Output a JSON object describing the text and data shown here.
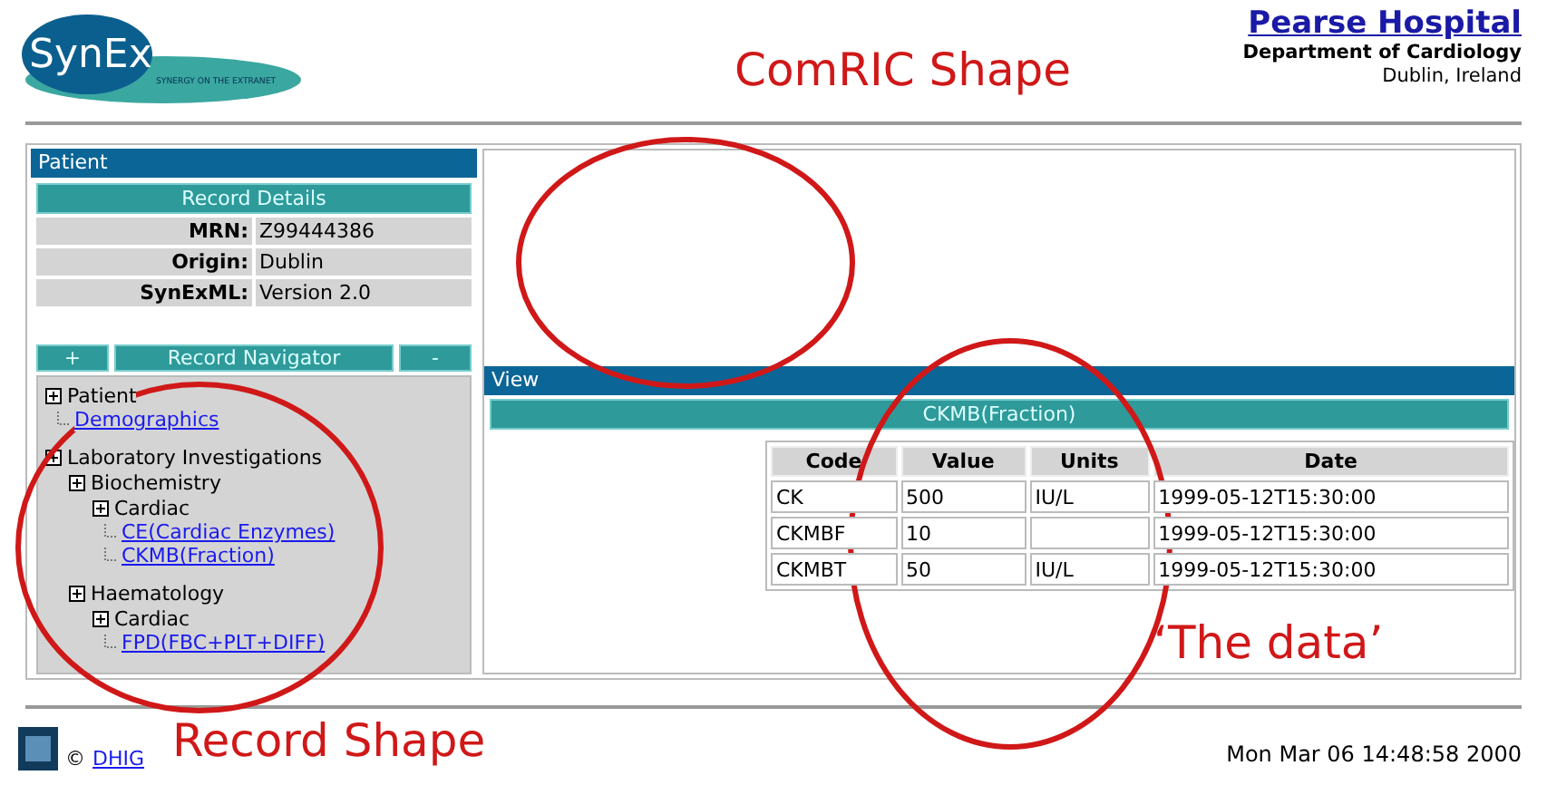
{
  "header": {
    "logo": {
      "name": "SynEx",
      "tagline": "SYNERGY ON THE EXTRANET"
    },
    "hospital": {
      "name": "Pearse Hospital",
      "department": "Department of Cardiology",
      "location": "Dublin, Ireland"
    }
  },
  "patient_panel": {
    "title": "Patient",
    "record_details": {
      "title": "Record Details",
      "rows": [
        {
          "label": "MRN:",
          "value": "Z99444386"
        },
        {
          "label": "Origin:",
          "value": "Dublin"
        },
        {
          "label": "SynExML:",
          "value": "Version 2.0"
        }
      ]
    }
  },
  "navigator": {
    "expand_button": "+",
    "title": "Record Navigator",
    "collapse_button": "-",
    "tree": [
      {
        "kind": "folder",
        "label": "Patient",
        "children": [
          {
            "kind": "link",
            "label": "Demographics"
          }
        ]
      },
      {
        "kind": "folder",
        "label": "Laboratory Investigations",
        "children": [
          {
            "kind": "folder",
            "label": "Biochemistry",
            "children": [
              {
                "kind": "folder",
                "label": "Cardiac",
                "children": [
                  {
                    "kind": "link",
                    "label": "CE(Cardiac Enzymes)"
                  },
                  {
                    "kind": "link",
                    "label": "CKMB(Fraction)"
                  }
                ]
              }
            ]
          },
          {
            "kind": "folder",
            "label": "Haematology",
            "children": [
              {
                "kind": "folder",
                "label": "Cardiac",
                "children": [
                  {
                    "kind": "link",
                    "label": "FPD(FBC+PLT+DIFF)"
                  }
                ]
              }
            ]
          }
        ]
      }
    ]
  },
  "view_panel": {
    "title": "View",
    "section_title": "CKMB(Fraction)",
    "table": {
      "columns": [
        "Code",
        "Value",
        "Units",
        "Date"
      ],
      "rows": [
        [
          "CK",
          "500",
          "IU/L",
          "1999-05-12T15:30:00"
        ],
        [
          "CKMBF",
          "10",
          "",
          "1999-05-12T15:30:00"
        ],
        [
          "CKMBT",
          "50",
          "IU/L",
          "1999-05-12T15:30:00"
        ]
      ]
    }
  },
  "footer": {
    "copyright": "©",
    "link": "DHIG",
    "datetime": "Mon Mar 06 14:48:58 2000"
  },
  "annotations": [
    {
      "label": "ComRIC Shape"
    },
    {
      "label": "‘The data’"
    },
    {
      "label": "Record Shape"
    }
  ]
}
